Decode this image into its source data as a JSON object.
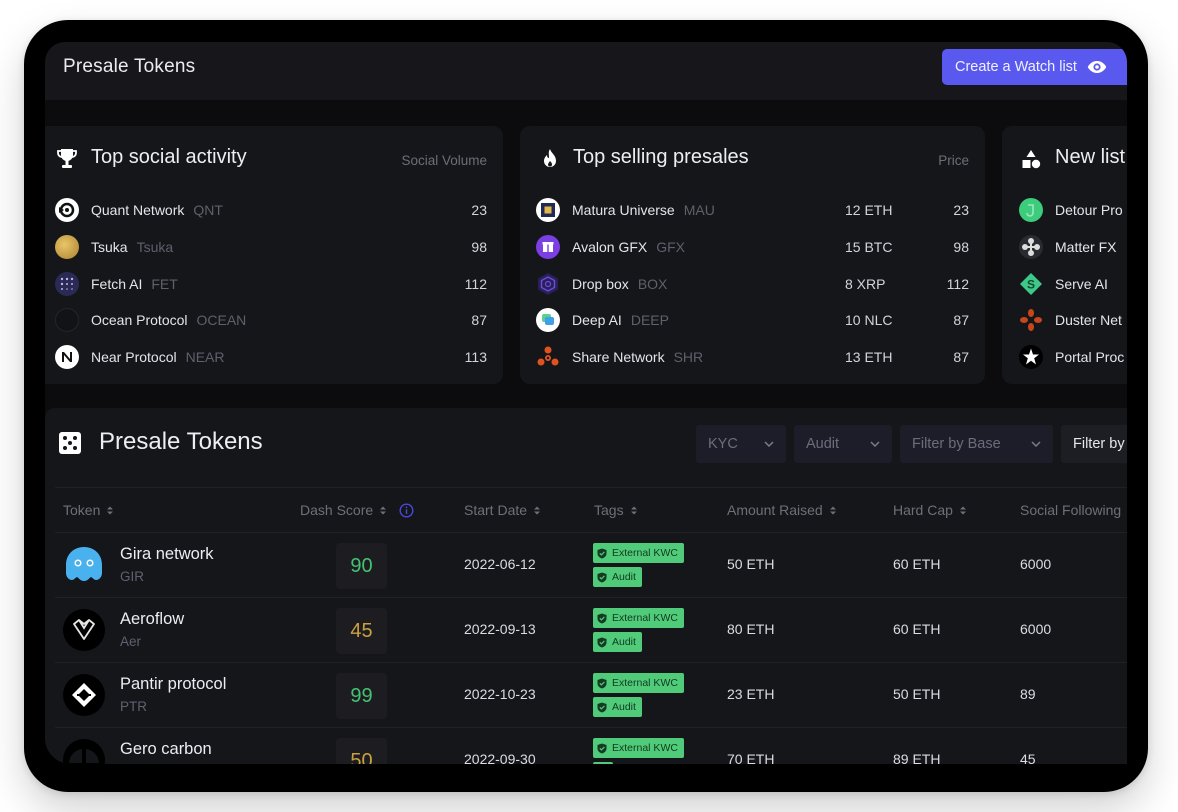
{
  "header": {
    "title": "Presale Tokens",
    "watch_button": "Create a Watch list"
  },
  "colors": {
    "accent": "#5a59ef",
    "score_high": "#45c172",
    "score_mid": "#c9a13e",
    "tag_bg": "#4fcb7a",
    "info_icon": "#4b49d8"
  },
  "cards": {
    "social": {
      "title": "Top social activity",
      "icon": "trophy-icon",
      "column": "Social Volume",
      "items": [
        {
          "name": "Quant Network",
          "symbol": "QNT",
          "value": "23"
        },
        {
          "name": "Tsuka",
          "symbol": "Tsuka",
          "value": "98"
        },
        {
          "name": "Fetch AI",
          "symbol": "FET",
          "value": "112"
        },
        {
          "name": "Ocean Protocol",
          "symbol": "OCEAN",
          "value": "87"
        },
        {
          "name": "Near Protocol",
          "symbol": "NEAR",
          "value": "113"
        }
      ]
    },
    "selling": {
      "title": "Top selling presales",
      "icon": "fire-icon",
      "column": "Price",
      "items": [
        {
          "name": "Matura Universe",
          "symbol": "MAU",
          "price": "12 ETH",
          "value": "23"
        },
        {
          "name": "Avalon GFX",
          "symbol": "GFX",
          "price": "15 BTC",
          "value": "98"
        },
        {
          "name": "Drop box",
          "symbol": "BOX",
          "price": "8 XRP",
          "value": "112"
        },
        {
          "name": "Deep AI",
          "symbol": "DEEP",
          "price": "10 NLC",
          "value": "87"
        },
        {
          "name": "Share Network",
          "symbol": "SHR",
          "price": "13 ETH",
          "value": "87"
        }
      ]
    },
    "new_listings": {
      "title": "New list",
      "icon": "shapes-icon",
      "items": [
        {
          "name": "Detour Pro"
        },
        {
          "name": "Matter FX"
        },
        {
          "name": "Serve AI"
        },
        {
          "name": "Duster Net"
        },
        {
          "name": "Portal Proc"
        }
      ]
    }
  },
  "table": {
    "title": "Presale Tokens",
    "filters": [
      "KYC",
      "Audit",
      "Filter by Base",
      "Filter by"
    ],
    "columns": [
      "Token",
      "Dash Score",
      "Start Date",
      "Tags",
      "Amount Raised",
      "Hard Cap",
      "Social Following"
    ],
    "rows": [
      {
        "name": "Gira network",
        "symbol": "GIR",
        "score": "90",
        "score_level": "high",
        "date": "2022-06-12",
        "tags": [
          "External KWC",
          "Audit"
        ],
        "raised": "50 ETH",
        "cap": "60 ETH",
        "social": "6000"
      },
      {
        "name": "Aeroflow",
        "symbol": "Aer",
        "score": "45",
        "score_level": "mid",
        "date": "2022-09-13",
        "tags": [
          "External KWC",
          "Audit"
        ],
        "raised": "80 ETH",
        "cap": "60 ETH",
        "social": "6000"
      },
      {
        "name": "Pantir protocol",
        "symbol": "PTR",
        "score": "99",
        "score_level": "high",
        "date": "2022-10-23",
        "tags": [
          "External KWC",
          "Audit"
        ],
        "raised": "23 ETH",
        "cap": "50 ETH",
        "social": "89"
      },
      {
        "name": "Gero carbon",
        "symbol": "",
        "score": "50",
        "score_level": "mid",
        "date": "2022-09-30",
        "tags": [
          "External KWC"
        ],
        "raised": "70 ETH",
        "cap": "89 ETH",
        "social": "45"
      }
    ]
  }
}
